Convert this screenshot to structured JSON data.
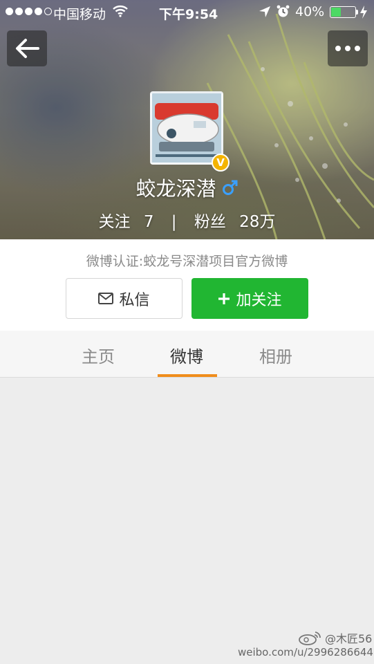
{
  "status_bar": {
    "carrier": "中国移动",
    "time": "下午9:54",
    "battery_percent": "40%",
    "battery_level": 0.4,
    "signal_bars": 4
  },
  "nav": {
    "back_icon": "back-arrow-icon",
    "more_icon": "more-dots-icon"
  },
  "profile": {
    "name": "蛟龙深潜",
    "verified_badge": "V",
    "following_label": "关注",
    "following_count": "7",
    "separator": "|",
    "followers_label": "粉丝",
    "followers_count": "28万",
    "verification": "微博认证:蛟龙号深潜项目官方微博"
  },
  "actions": {
    "message_label": "私信",
    "follow_label": "加关注"
  },
  "tabs": [
    {
      "label": "主页",
      "active": false
    },
    {
      "label": "微博",
      "active": true
    },
    {
      "label": "相册",
      "active": false
    }
  ],
  "watermark": {
    "handle": "@木匠56",
    "url": "weibo.com/u/2996286644"
  },
  "colors": {
    "follow_green": "#21b632",
    "tab_indicator": "#f08d1c",
    "verified_gold": "#f4b400",
    "gender_blue": "#3aa0ff"
  }
}
